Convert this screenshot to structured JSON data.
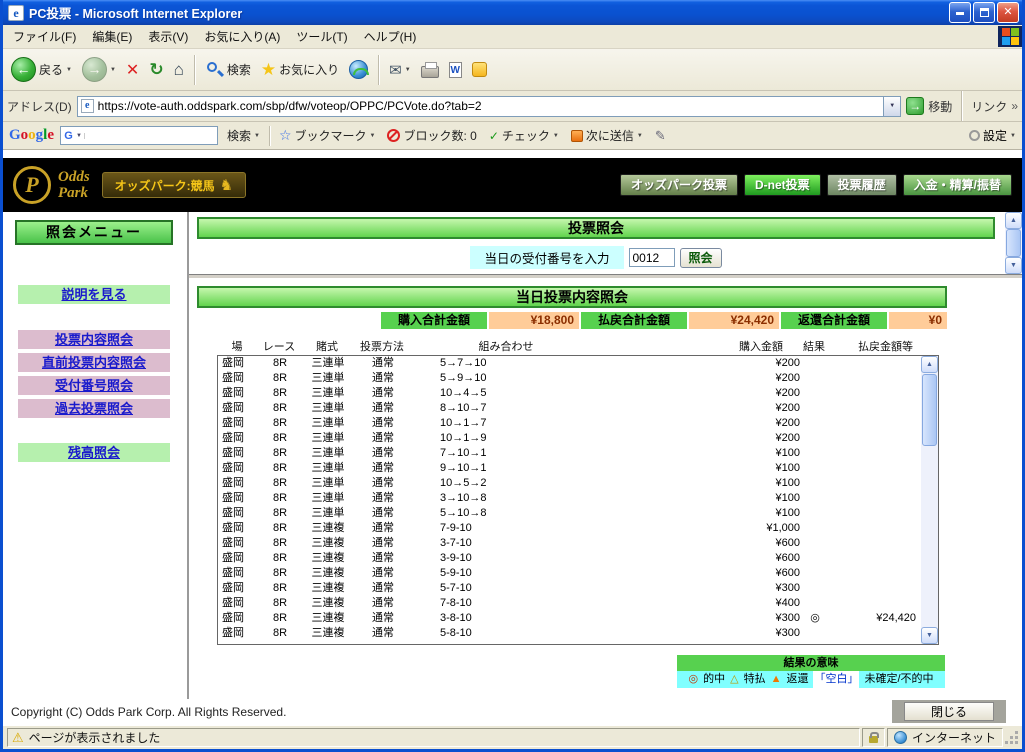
{
  "icons": {
    "ie_e": "e",
    "close_x": "✕",
    "back_arrow": "←",
    "forward_arrow": "→",
    "stop_x": "✕",
    "refresh_arrow": "↻",
    "home": "⌂",
    "star": "★",
    "star_outline": "☆",
    "mail": "✉",
    "dropdown": "▼",
    "arrow_up": "▲",
    "arrow_down": "▼",
    "go_arrow": "→",
    "chevrons": "»",
    "warning": "⚠",
    "horse": "♞",
    "check": "✓",
    "pen": "✎",
    "word_w": "W",
    "google_g": "G",
    "brand_p": "P"
  },
  "colors": {
    "titlebar_blue": "#0a51cf",
    "header_green": "#62d44e",
    "menu_green_border": "#267326",
    "link_blue": "#1a1acc",
    "sidebar_green": "#b6f0ae",
    "sidebar_pink": "#dcbcce",
    "summary_label_green": "#57d14f",
    "summary_value_orange": "#ffcc99",
    "legend_cyan": "#80ffff",
    "brand_gold": "#c9a227"
  },
  "window": {
    "title": "PC投票 - Microsoft Internet Explorer",
    "status_left": "ページが表示されました",
    "status_zone": "インターネット"
  },
  "menu": {
    "items": [
      "ファイル(F)",
      "編集(E)",
      "表示(V)",
      "お気に入り(A)",
      "ツール(T)",
      "ヘルプ(H)"
    ]
  },
  "toolbar": {
    "back": "戻る",
    "search": "検索",
    "favorites": "お気に入り"
  },
  "address": {
    "label": "アドレス(D)",
    "url": "https://vote-auth.oddspark.com/sbp/dfw/voteop/OPPC/PCVote.do?tab=2",
    "go": "移動",
    "links": "リンク"
  },
  "google": {
    "logo_letters": [
      "G",
      "o",
      "o",
      "g",
      "l",
      "e"
    ],
    "search": "検索",
    "bookmarks": "ブックマーク",
    "blocked": "ブロック数: 0",
    "check": "チェック",
    "send": "次に送信",
    "settings": "設定"
  },
  "site": {
    "brand_line1": "Odds",
    "brand_line2": "Park",
    "badge": "オッズパーク:競馬",
    "nav": [
      {
        "label": "オッズパーク投票"
      },
      {
        "label": "D-net投票"
      },
      {
        "label": "投票履歴"
      },
      {
        "label": "入金・精算/振替"
      }
    ]
  },
  "sidebar": {
    "title": "照会メニュー",
    "items": [
      {
        "label": "説明を見る"
      },
      {
        "label": "投票内容照会"
      },
      {
        "label": "直前投票内容照会"
      },
      {
        "label": "受付番号照会"
      },
      {
        "label": "過去投票照会"
      },
      {
        "label": "残高照会"
      }
    ]
  },
  "main": {
    "inquiry_title": "投票照会",
    "receipt_label": "当日の受付番号を入力",
    "receipt_value": "0012",
    "submit": "照会",
    "detail_title": "当日投票内容照会",
    "summary": [
      {
        "label": "購入合計金額",
        "value": "¥18,800"
      },
      {
        "label": "払戻合計金額",
        "value": "¥24,420"
      },
      {
        "label": "返還合計金額",
        "value": "¥0"
      }
    ],
    "table": {
      "headers": [
        "場",
        "レース",
        "賭式",
        "投票方法",
        "組み合わせ",
        "購入金額",
        "結果",
        "払戻金額等"
      ],
      "rows": [
        [
          "盛岡",
          "8R",
          "三連単",
          "通常",
          "5→7→10",
          "¥200",
          "",
          ""
        ],
        [
          "盛岡",
          "8R",
          "三連単",
          "通常",
          "5→9→10",
          "¥200",
          "",
          ""
        ],
        [
          "盛岡",
          "8R",
          "三連単",
          "通常",
          "10→4→5",
          "¥200",
          "",
          ""
        ],
        [
          "盛岡",
          "8R",
          "三連単",
          "通常",
          "8→10→7",
          "¥200",
          "",
          ""
        ],
        [
          "盛岡",
          "8R",
          "三連単",
          "通常",
          "10→1→7",
          "¥200",
          "",
          ""
        ],
        [
          "盛岡",
          "8R",
          "三連単",
          "通常",
          "10→1→9",
          "¥200",
          "",
          ""
        ],
        [
          "盛岡",
          "8R",
          "三連単",
          "通常",
          "7→10→1",
          "¥100",
          "",
          ""
        ],
        [
          "盛岡",
          "8R",
          "三連単",
          "通常",
          "9→10→1",
          "¥100",
          "",
          ""
        ],
        [
          "盛岡",
          "8R",
          "三連単",
          "通常",
          "10→5→2",
          "¥100",
          "",
          ""
        ],
        [
          "盛岡",
          "8R",
          "三連単",
          "通常",
          "3→10→8",
          "¥100",
          "",
          ""
        ],
        [
          "盛岡",
          "8R",
          "三連単",
          "通常",
          "5→10→8",
          "¥100",
          "",
          ""
        ],
        [
          "盛岡",
          "8R",
          "三連複",
          "通常",
          "7-9-10",
          "¥1,000",
          "",
          ""
        ],
        [
          "盛岡",
          "8R",
          "三連複",
          "通常",
          "3-7-10",
          "¥600",
          "",
          ""
        ],
        [
          "盛岡",
          "8R",
          "三連複",
          "通常",
          "3-9-10",
          "¥600",
          "",
          ""
        ],
        [
          "盛岡",
          "8R",
          "三連複",
          "通常",
          "5-9-10",
          "¥600",
          "",
          ""
        ],
        [
          "盛岡",
          "8R",
          "三連複",
          "通常",
          "5-7-10",
          "¥300",
          "",
          ""
        ],
        [
          "盛岡",
          "8R",
          "三連複",
          "通常",
          "7-8-10",
          "¥400",
          "",
          ""
        ],
        [
          "盛岡",
          "8R",
          "三連複",
          "通常",
          "3-8-10",
          "¥300",
          "◎",
          "¥24,420"
        ],
        [
          "盛岡",
          "8R",
          "三連複",
          "通常",
          "5-8-10",
          "¥300",
          "",
          ""
        ]
      ]
    },
    "legend": {
      "title": "結果の意味",
      "items": [
        {
          "mark": "◎",
          "label": "的中"
        },
        {
          "mark": "△",
          "label": "特払"
        },
        {
          "mark": "▲",
          "label": "返還"
        },
        {
          "mark": "「空白」",
          "label": "未確定/不的中"
        }
      ]
    }
  },
  "footer": {
    "copyright": "Copyright (C) Odds Park Corp. All Rights Reserved.",
    "close": "閉じる"
  }
}
